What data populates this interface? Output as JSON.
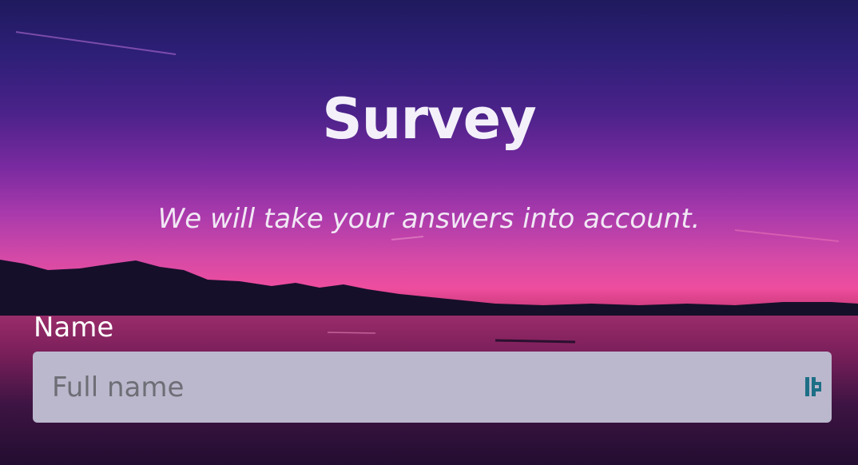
{
  "header": {
    "title": "Survey",
    "subtitle": "We will take your answers into account."
  },
  "form": {
    "name_label": "Name",
    "name_placeholder": "Full name",
    "name_value": ""
  },
  "icons": {
    "input_extension_icon": "password-manager-icon"
  },
  "colors": {
    "title_text": "#f3f0fa",
    "input_background": "#bbb8cd",
    "icon_color": "#1c6f86"
  }
}
